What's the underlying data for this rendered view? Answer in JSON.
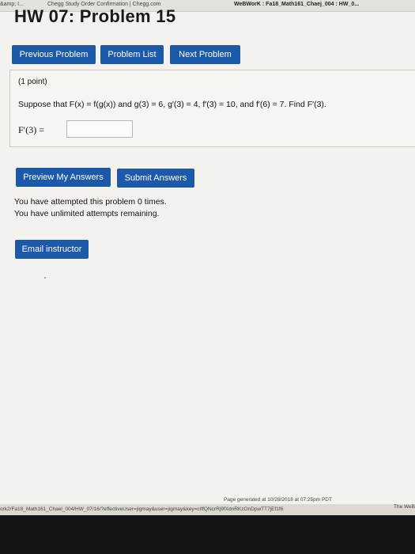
{
  "browser": {
    "tabs": [
      {
        "label": "&amp; I..."
      },
      {
        "label": "Chegg Study Order Confirmation | Chegg.com"
      },
      {
        "label": "WeBWorK : Fa18_Math161_Chaej_004 : HW_0..."
      }
    ]
  },
  "page": {
    "title": "HW 07: Problem 15"
  },
  "nav": {
    "prev_label": "Previous Problem",
    "list_label": "Problem List",
    "next_label": "Next Problem"
  },
  "problem": {
    "points": "(1 point)",
    "statement": "Suppose that F(x) = f(g(x)) and g(3) = 6, g′(3) = 4, f′(3) = 10, and f′(6) = 7. Find F′(3).",
    "answer_label": "F′(3) =",
    "answer_value": ""
  },
  "actions": {
    "preview_label": "Preview My Answers",
    "submit_label": "Submit Answers"
  },
  "attempts": {
    "line1": "You have attempted this problem 0 times.",
    "line2": "You have unlimited attempts remaining."
  },
  "email": {
    "label": "Email instructor"
  },
  "footer": {
    "generated": "Page generated at 10/28/2018 at 07:25pm PDT",
    "status_url": "ork2/Fa18_Math161_Chael_004/HW_07/16/?effectiveUser=jigmay&user=jigmay&key=cIffQNcrRj9fXdnRKzOnDpwTT7jEf1f6",
    "status_right": "The WeB"
  }
}
